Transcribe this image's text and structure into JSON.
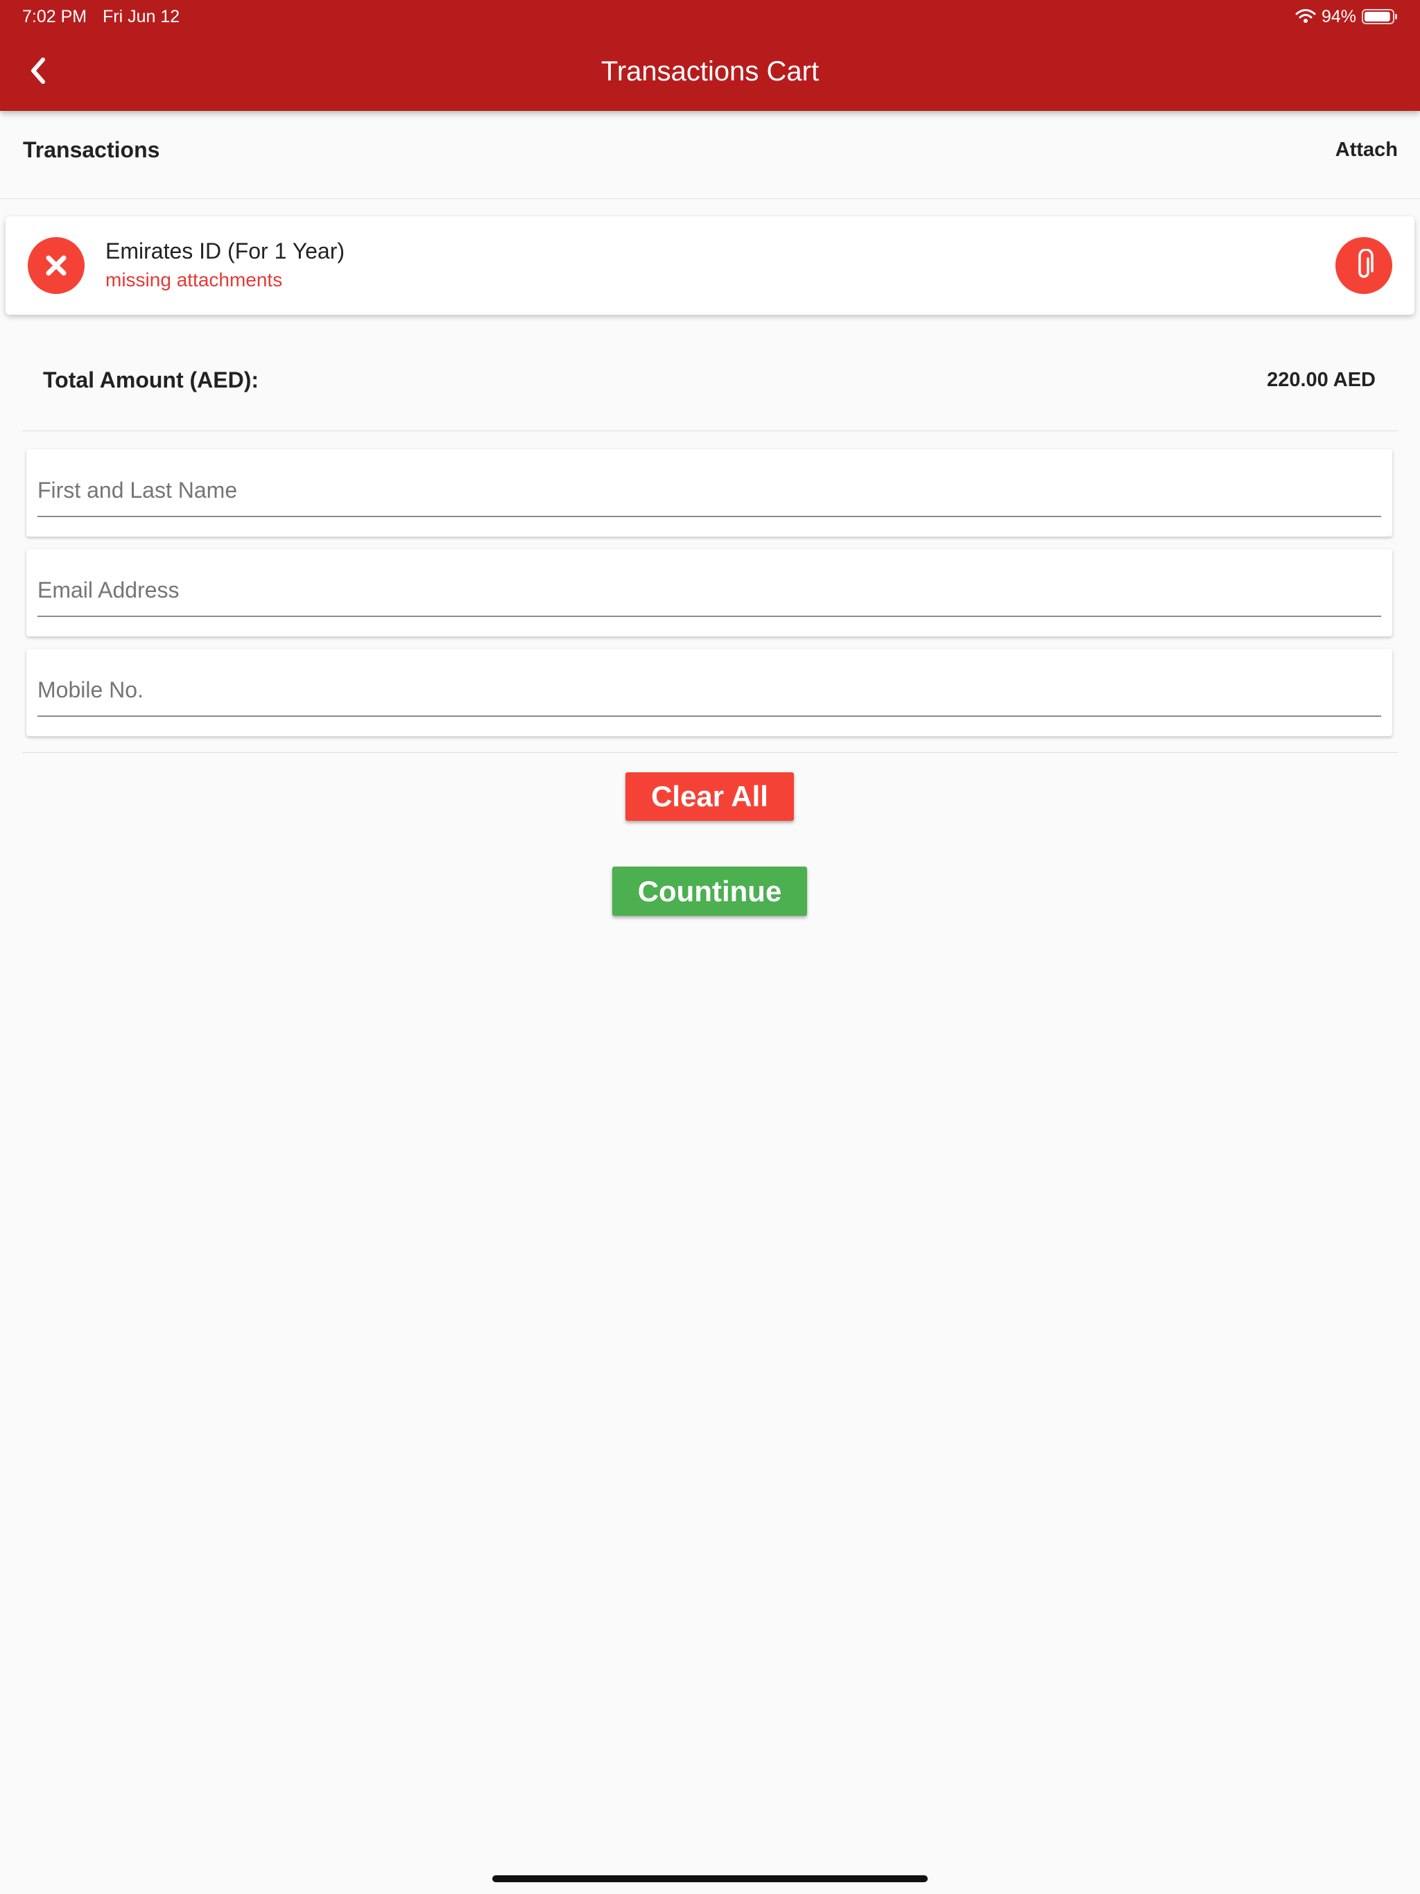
{
  "status_bar": {
    "time": "7:02 PM",
    "date": "Fri Jun 12",
    "battery": "94%",
    "battery_level": 0.94
  },
  "header": {
    "title": "Transactions Cart",
    "back_icon": "chevron-left-icon"
  },
  "section": {
    "title": "Transactions",
    "action": "Attach"
  },
  "transactions": [
    {
      "name": "Emirates ID (For 1 Year)",
      "status": "missing attachments",
      "remove_icon": "close-icon",
      "attach_icon": "paperclip-icon"
    }
  ],
  "total": {
    "label": "Total Amount (AED):",
    "value": "220.00 AED"
  },
  "form": {
    "name_placeholder": "First and Last Name",
    "name_value": "",
    "email_placeholder": "Email Address",
    "email_value": "",
    "mobile_placeholder": "Mobile No.",
    "mobile_value": ""
  },
  "buttons": {
    "clear": "Clear All",
    "continue": "Countinue"
  },
  "colors": {
    "appbar": "#b71c1c",
    "danger": "#f44336",
    "success": "#4caf50",
    "error_text": "#e53935"
  }
}
